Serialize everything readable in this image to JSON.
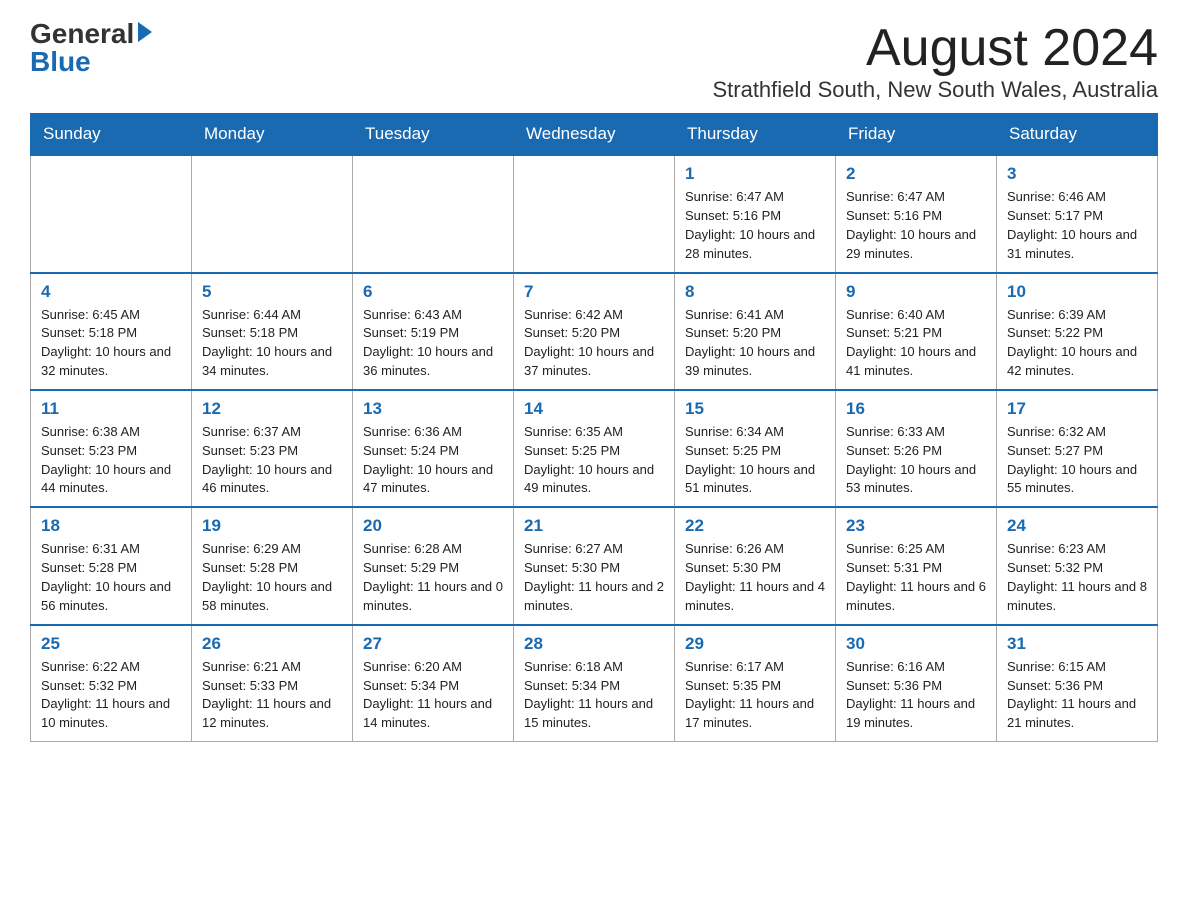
{
  "header": {
    "logo_general": "General",
    "logo_blue": "Blue",
    "month_title": "August 2024",
    "location": "Strathfield South, New South Wales, Australia"
  },
  "calendar": {
    "days_of_week": [
      "Sunday",
      "Monday",
      "Tuesday",
      "Wednesday",
      "Thursday",
      "Friday",
      "Saturday"
    ],
    "weeks": [
      [
        {
          "day": "",
          "info": ""
        },
        {
          "day": "",
          "info": ""
        },
        {
          "day": "",
          "info": ""
        },
        {
          "day": "",
          "info": ""
        },
        {
          "day": "1",
          "info": "Sunrise: 6:47 AM\nSunset: 5:16 PM\nDaylight: 10 hours and 28 minutes."
        },
        {
          "day": "2",
          "info": "Sunrise: 6:47 AM\nSunset: 5:16 PM\nDaylight: 10 hours and 29 minutes."
        },
        {
          "day": "3",
          "info": "Sunrise: 6:46 AM\nSunset: 5:17 PM\nDaylight: 10 hours and 31 minutes."
        }
      ],
      [
        {
          "day": "4",
          "info": "Sunrise: 6:45 AM\nSunset: 5:18 PM\nDaylight: 10 hours and 32 minutes."
        },
        {
          "day": "5",
          "info": "Sunrise: 6:44 AM\nSunset: 5:18 PM\nDaylight: 10 hours and 34 minutes."
        },
        {
          "day": "6",
          "info": "Sunrise: 6:43 AM\nSunset: 5:19 PM\nDaylight: 10 hours and 36 minutes."
        },
        {
          "day": "7",
          "info": "Sunrise: 6:42 AM\nSunset: 5:20 PM\nDaylight: 10 hours and 37 minutes."
        },
        {
          "day": "8",
          "info": "Sunrise: 6:41 AM\nSunset: 5:20 PM\nDaylight: 10 hours and 39 minutes."
        },
        {
          "day": "9",
          "info": "Sunrise: 6:40 AM\nSunset: 5:21 PM\nDaylight: 10 hours and 41 minutes."
        },
        {
          "day": "10",
          "info": "Sunrise: 6:39 AM\nSunset: 5:22 PM\nDaylight: 10 hours and 42 minutes."
        }
      ],
      [
        {
          "day": "11",
          "info": "Sunrise: 6:38 AM\nSunset: 5:23 PM\nDaylight: 10 hours and 44 minutes."
        },
        {
          "day": "12",
          "info": "Sunrise: 6:37 AM\nSunset: 5:23 PM\nDaylight: 10 hours and 46 minutes."
        },
        {
          "day": "13",
          "info": "Sunrise: 6:36 AM\nSunset: 5:24 PM\nDaylight: 10 hours and 47 minutes."
        },
        {
          "day": "14",
          "info": "Sunrise: 6:35 AM\nSunset: 5:25 PM\nDaylight: 10 hours and 49 minutes."
        },
        {
          "day": "15",
          "info": "Sunrise: 6:34 AM\nSunset: 5:25 PM\nDaylight: 10 hours and 51 minutes."
        },
        {
          "day": "16",
          "info": "Sunrise: 6:33 AM\nSunset: 5:26 PM\nDaylight: 10 hours and 53 minutes."
        },
        {
          "day": "17",
          "info": "Sunrise: 6:32 AM\nSunset: 5:27 PM\nDaylight: 10 hours and 55 minutes."
        }
      ],
      [
        {
          "day": "18",
          "info": "Sunrise: 6:31 AM\nSunset: 5:28 PM\nDaylight: 10 hours and 56 minutes."
        },
        {
          "day": "19",
          "info": "Sunrise: 6:29 AM\nSunset: 5:28 PM\nDaylight: 10 hours and 58 minutes."
        },
        {
          "day": "20",
          "info": "Sunrise: 6:28 AM\nSunset: 5:29 PM\nDaylight: 11 hours and 0 minutes."
        },
        {
          "day": "21",
          "info": "Sunrise: 6:27 AM\nSunset: 5:30 PM\nDaylight: 11 hours and 2 minutes."
        },
        {
          "day": "22",
          "info": "Sunrise: 6:26 AM\nSunset: 5:30 PM\nDaylight: 11 hours and 4 minutes."
        },
        {
          "day": "23",
          "info": "Sunrise: 6:25 AM\nSunset: 5:31 PM\nDaylight: 11 hours and 6 minutes."
        },
        {
          "day": "24",
          "info": "Sunrise: 6:23 AM\nSunset: 5:32 PM\nDaylight: 11 hours and 8 minutes."
        }
      ],
      [
        {
          "day": "25",
          "info": "Sunrise: 6:22 AM\nSunset: 5:32 PM\nDaylight: 11 hours and 10 minutes."
        },
        {
          "day": "26",
          "info": "Sunrise: 6:21 AM\nSunset: 5:33 PM\nDaylight: 11 hours and 12 minutes."
        },
        {
          "day": "27",
          "info": "Sunrise: 6:20 AM\nSunset: 5:34 PM\nDaylight: 11 hours and 14 minutes."
        },
        {
          "day": "28",
          "info": "Sunrise: 6:18 AM\nSunset: 5:34 PM\nDaylight: 11 hours and 15 minutes."
        },
        {
          "day": "29",
          "info": "Sunrise: 6:17 AM\nSunset: 5:35 PM\nDaylight: 11 hours and 17 minutes."
        },
        {
          "day": "30",
          "info": "Sunrise: 6:16 AM\nSunset: 5:36 PM\nDaylight: 11 hours and 19 minutes."
        },
        {
          "day": "31",
          "info": "Sunrise: 6:15 AM\nSunset: 5:36 PM\nDaylight: 11 hours and 21 minutes."
        }
      ]
    ]
  }
}
